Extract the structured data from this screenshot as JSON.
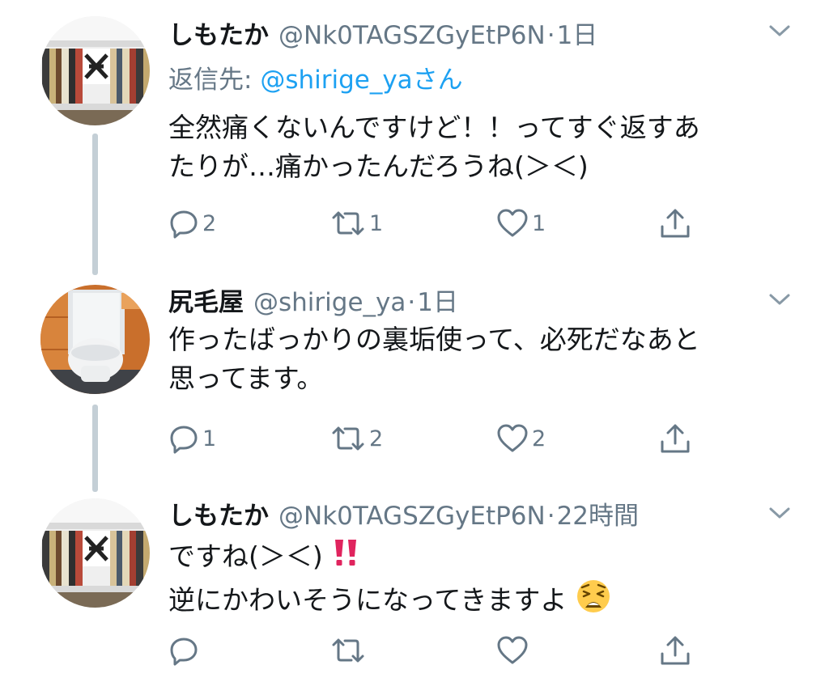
{
  "tweets": [
    {
      "display_name": "しもたか",
      "handle": "@Nk0TAGSZGyEtP6N",
      "separator": "·",
      "time": "1日",
      "reply_label": "返信先: ",
      "reply_mention": "@shirige_ya",
      "reply_suffix": "さん",
      "lines": [
        "全然痛くないんですけど！！ってすぐ返すあ",
        "たりが…痛かったんだろうね(＞＜)"
      ],
      "replies": "2",
      "retweets": "1",
      "likes": "1"
    },
    {
      "display_name": "尻毛屋",
      "handle": "@shirige_ya",
      "separator": "·",
      "time": "1日",
      "lines": [
        "作ったばっかりの裏垢使って、必死だなあと",
        "思ってます。"
      ],
      "replies": "1",
      "retweets": "2",
      "likes": "2"
    },
    {
      "display_name": "しもたか",
      "handle": "@Nk0TAGSZGyEtP6N",
      "separator": "·",
      "time": "22時間",
      "lines": [
        "ですね(＞＜)",
        "逆にかわいそうになってきますよ"
      ],
      "replies": "",
      "retweets": "",
      "likes": ""
    }
  ],
  "icons": {
    "reply": "reply-icon",
    "retweet": "retweet-icon",
    "like": "heart-icon",
    "share": "share-icon",
    "caret": "chevron-down-icon",
    "emphasis": "double-exclamation-icon",
    "emoji": "weary-face-icon"
  },
  "colors": {
    "link": "#1da1f2",
    "secondary_text": "#657786",
    "thread_line": "#c4cfd6",
    "emphasis_red": "#e0245e"
  }
}
